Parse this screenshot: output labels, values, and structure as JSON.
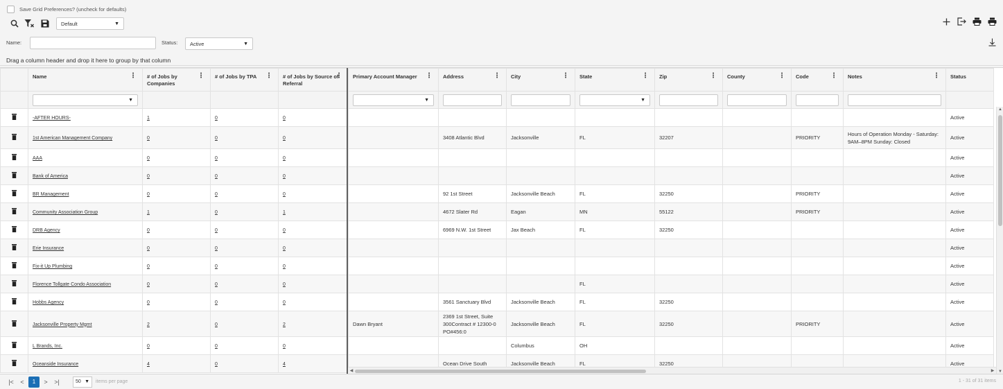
{
  "prefs": {
    "label": "Save Grid Preferences? (uncheck for defaults)"
  },
  "toolbar": {
    "view_select": "Default"
  },
  "filters": {
    "name_label": "Name:",
    "status_label": "Status:",
    "status_value": "Active"
  },
  "group_bar": "Drag a column header and drop it here to group by that column",
  "columns": {
    "name": "Name",
    "jobs_companies": "# of Jobs by Companies",
    "jobs_tpa": "# of Jobs by TPA",
    "jobs_referral": "# of Jobs by Source of Referral",
    "account_manager": "Primary Account Manager",
    "address": "Address",
    "city": "City",
    "state": "State",
    "zip": "Zip",
    "county": "County",
    "code": "Code",
    "notes": "Notes",
    "status": "Status"
  },
  "rows": [
    {
      "name": "-AFTER HOURS-",
      "c": "1",
      "t": "0",
      "r": "0",
      "mgr": "",
      "addr": "",
      "city": "",
      "state": "",
      "zip": "",
      "county": "",
      "code": "",
      "notes": "",
      "status": "Active"
    },
    {
      "name": "1st American Management Company",
      "c": "0",
      "t": "0",
      "r": "0",
      "mgr": "",
      "addr": "3408 Atlantic Blvd",
      "city": "Jacksonville",
      "state": "FL",
      "zip": "32207",
      "county": "",
      "code": "PRIORITY",
      "notes": "Hours of Operation Monday - Saturday: 9AM–8PM Sunday: Closed",
      "status": "Active"
    },
    {
      "name": "AAA",
      "c": "0",
      "t": "0",
      "r": "0",
      "mgr": "",
      "addr": "",
      "city": "",
      "state": "",
      "zip": "",
      "county": "",
      "code": "",
      "notes": "",
      "status": "Active"
    },
    {
      "name": "Bank of America",
      "c": "0",
      "t": "0",
      "r": "0",
      "mgr": "",
      "addr": "",
      "city": "",
      "state": "",
      "zip": "",
      "county": "",
      "code": "",
      "notes": "",
      "status": "Active"
    },
    {
      "name": "BR Management",
      "c": "0",
      "t": "0",
      "r": "0",
      "mgr": "",
      "addr": "92 1st Street",
      "city": "Jacksonville Beach",
      "state": "FL",
      "zip": "32250",
      "county": "",
      "code": "PRIORITY",
      "notes": "",
      "status": "Active"
    },
    {
      "name": "Community Association Group",
      "c": "1",
      "t": "0",
      "r": "1",
      "mgr": "",
      "addr": "4672 Slater Rd",
      "city": "Eagan",
      "state": "MN",
      "zip": "55122",
      "county": "",
      "code": "PRIORITY",
      "notes": "",
      "status": "Active"
    },
    {
      "name": "DRB Agency",
      "c": "0",
      "t": "0",
      "r": "0",
      "mgr": "",
      "addr": "6969 N.W. 1st Street",
      "city": "Jax Beach",
      "state": "FL",
      "zip": "32250",
      "county": "",
      "code": "",
      "notes": "",
      "status": "Active"
    },
    {
      "name": "Erie Insurance",
      "c": "0",
      "t": "0",
      "r": "0",
      "mgr": "",
      "addr": "",
      "city": "",
      "state": "",
      "zip": "",
      "county": "",
      "code": "",
      "notes": "",
      "status": "Active"
    },
    {
      "name": "Fix-it Up Plumbing",
      "c": "0",
      "t": "0",
      "r": "0",
      "mgr": "",
      "addr": "",
      "city": "",
      "state": "",
      "zip": "",
      "county": "",
      "code": "",
      "notes": "",
      "status": "Active"
    },
    {
      "name": "Florence Tollgate Condo Association",
      "c": "0",
      "t": "0",
      "r": "0",
      "mgr": "",
      "addr": "",
      "city": "",
      "state": "FL",
      "zip": "",
      "county": "",
      "code": "",
      "notes": "",
      "status": "Active"
    },
    {
      "name": "Hobbs Agency",
      "c": "0",
      "t": "0",
      "r": "0",
      "mgr": "",
      "addr": "3561 Sanctuary Blvd",
      "city": "Jacksonville Beach",
      "state": "FL",
      "zip": "32250",
      "county": "",
      "code": "",
      "notes": "",
      "status": "Active"
    },
    {
      "name": "Jacksonville Property Mgmt",
      "c": "2",
      "t": "0",
      "r": "2",
      "mgr": "Dawn Bryant",
      "addr": "2369 1st Street, Suite 300Contract # 12300-0 PO#456:0",
      "city": "Jacksonville Beach",
      "state": "FL",
      "zip": "32250",
      "county": "",
      "code": "PRIORITY",
      "notes": "",
      "status": "Active"
    },
    {
      "name": "L Brands, Inc.",
      "c": "0",
      "t": "0",
      "r": "0",
      "mgr": "",
      "addr": "",
      "city": "Columbus",
      "state": "OH",
      "zip": "",
      "county": "",
      "code": "",
      "notes": "",
      "status": "Active"
    },
    {
      "name": "Oceanside Insurance",
      "c": "4",
      "t": "0",
      "r": "4",
      "mgr": "",
      "addr": "Ocean Drive South",
      "city": "Jacksonville Beach",
      "state": "FL",
      "zip": "32250",
      "county": "",
      "code": "",
      "notes": "",
      "status": "Active"
    }
  ],
  "pager": {
    "current": "1",
    "per_page": "50",
    "per_page_label": "items per page",
    "info": "1 - 31 of 31 items"
  },
  "colors": {
    "accent": "#1c6fb5"
  }
}
